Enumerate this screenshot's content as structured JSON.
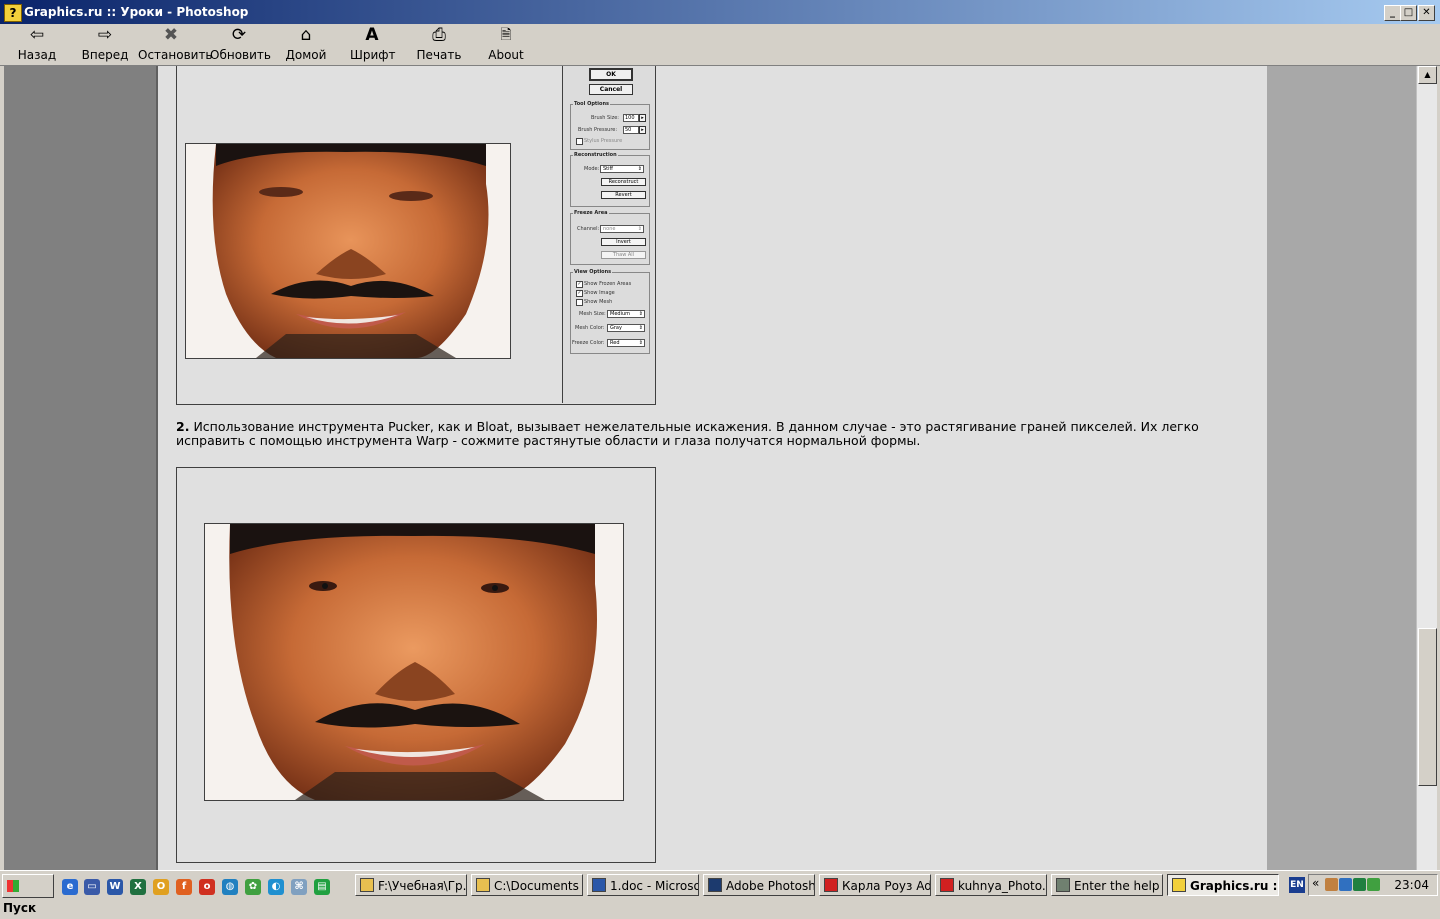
{
  "window": {
    "title": "Graphics.ru :: Уроки - Photoshop",
    "minimize": "_",
    "maximize": "□",
    "close": "✕"
  },
  "toolbar": {
    "buttons": [
      {
        "label": "Назад",
        "icon": "arrow-left-icon",
        "glyph": "⇦"
      },
      {
        "label": "Вперед",
        "icon": "arrow-right-icon",
        "glyph": "⇨"
      },
      {
        "label": "Остановить",
        "icon": "stop-icon",
        "glyph": "✖"
      },
      {
        "label": "Обновить",
        "icon": "refresh-icon",
        "glyph": "⟳"
      },
      {
        "label": "Домой",
        "icon": "home-icon",
        "glyph": "⌂"
      },
      {
        "label": "Шрифт",
        "icon": "font-icon",
        "glyph": "A"
      },
      {
        "label": "Печать",
        "icon": "print-icon",
        "glyph": "⎙"
      },
      {
        "label": "About",
        "icon": "about-icon",
        "glyph": "🗎"
      }
    ]
  },
  "liquify_panel": {
    "ok": "OK",
    "cancel": "Cancel",
    "tool_options": {
      "title": "Tool Options",
      "brush_size_label": "Brush Size:",
      "brush_size": "100",
      "brush_pressure_label": "Brush Pressure:",
      "brush_pressure": "50",
      "stylus_pressure": "Stylus Pressure"
    },
    "reconstruction": {
      "title": "Reconstruction",
      "mode_label": "Mode:",
      "mode": "Stiff",
      "reconstruct": "Reconstruct",
      "revert": "Revert"
    },
    "freeze_area": {
      "title": "Freeze Area",
      "channel_label": "Channel:",
      "channel": "none",
      "invert": "Invert",
      "thaw_all": "Thaw All"
    },
    "view_options": {
      "title": "View Options",
      "show_frozen": "Show Frozen Areas",
      "show_image": "Show Image",
      "show_mesh": "Show Mesh",
      "mesh_size_label": "Mesh Size:",
      "mesh_size": "Medium",
      "mesh_color_label": "Mesh Color:",
      "mesh_color": "Gray",
      "freeze_color_label": "Freeze Color:",
      "freeze_color": "Red"
    }
  },
  "article": {
    "step_number": "2.",
    "text": "Использование инструмента Pucker, как и Bloat, вызывает нежелательные искажения. В данном случае - это растягивание граней пикселей. Их легко исправить с помощью инструмента Warp - сожмите растянутые области и глаза получатся нормальной формы."
  },
  "taskbar": {
    "start": "Пуск",
    "tasks": [
      {
        "label": "F:\\Учебная\\Гр...",
        "color": "#e8c050"
      },
      {
        "label": "C:\\Documents ...",
        "color": "#e8c050"
      },
      {
        "label": "1.doc - Microso...",
        "color": "#2b57a8"
      },
      {
        "label": "Adobe Photosh...",
        "color": "#1c3a6e"
      },
      {
        "label": "Карла Роуз Ad...",
        "color": "#d02020"
      },
      {
        "label": "kuhnya_Photo...",
        "color": "#d02020"
      },
      {
        "label": "Enter the help ...",
        "color": "#708070"
      },
      {
        "label": "Graphics.ru :: ...",
        "color": "#f2d03b"
      }
    ],
    "lang": "EN",
    "expand": "«",
    "clock": "23:04"
  }
}
